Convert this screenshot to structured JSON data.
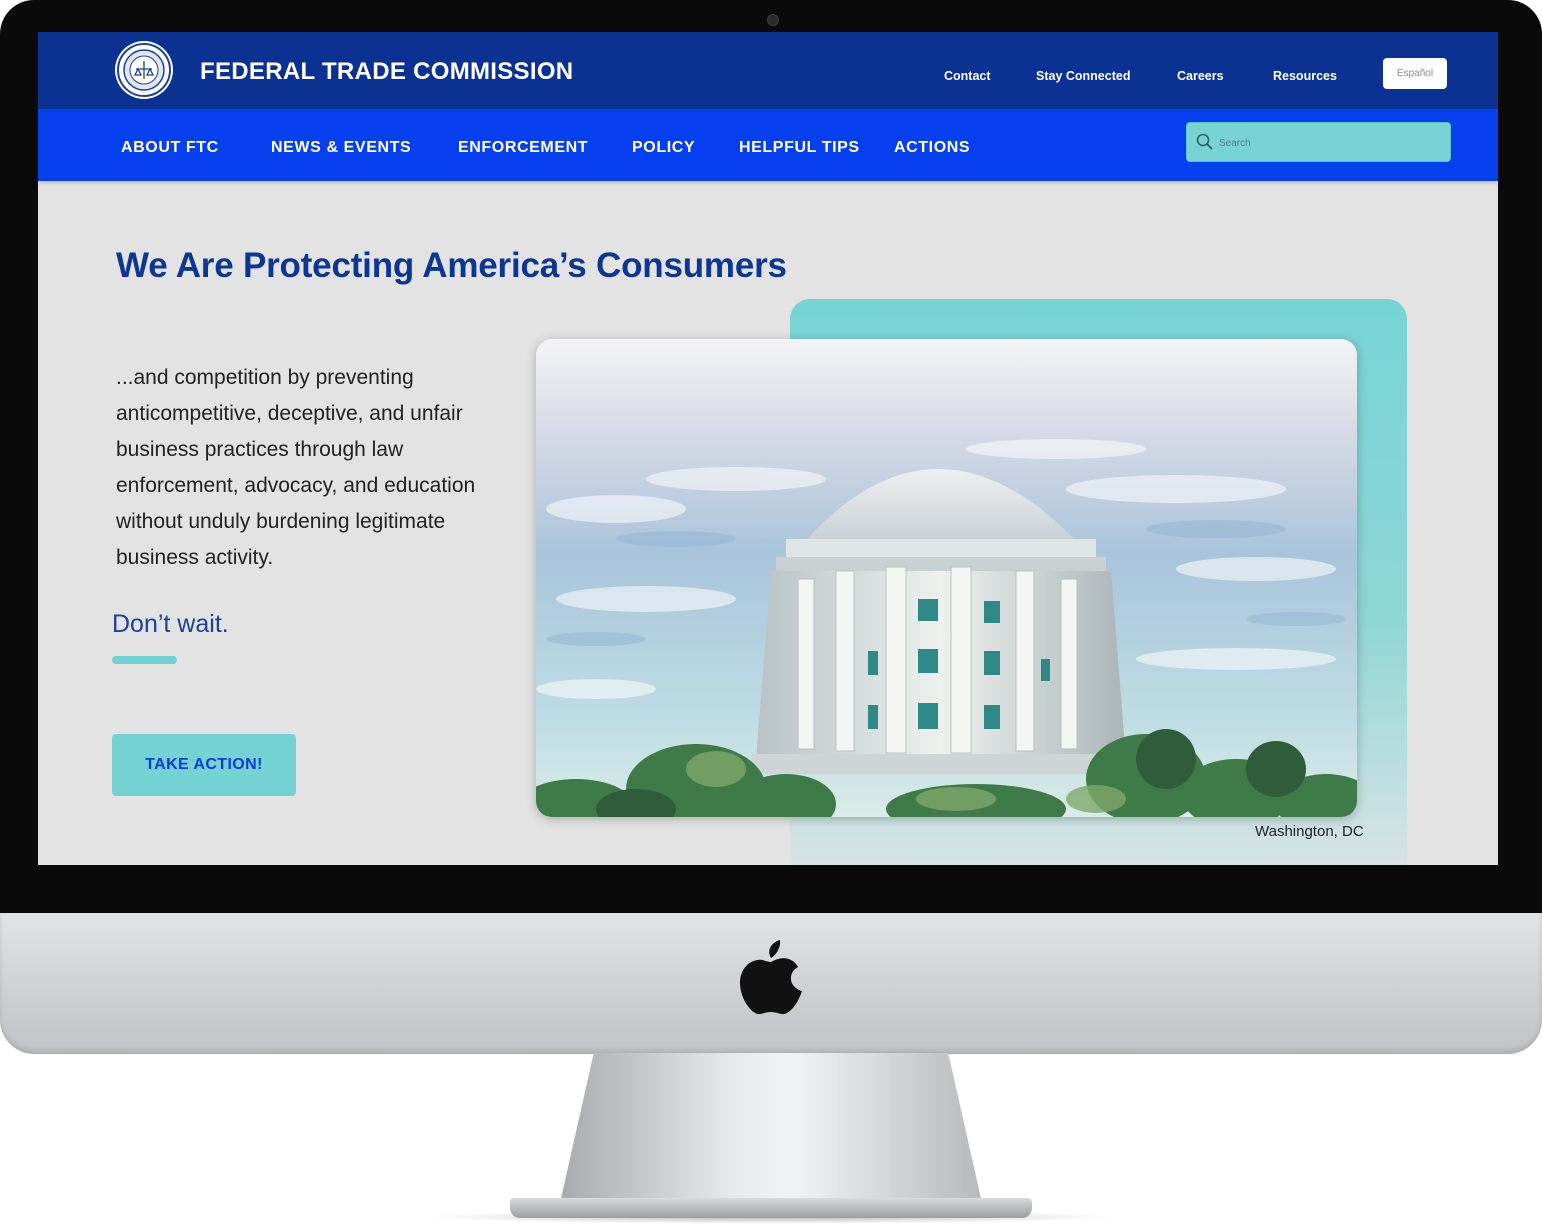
{
  "header": {
    "brand": "FEDERAL TRADE COMMISSION",
    "utility_links": [
      "Contact",
      "Stay Connected",
      "Careers",
      "Resources"
    ],
    "language_button": "Español"
  },
  "nav": {
    "items": [
      "ABOUT FTC",
      "NEWS & EVENTS",
      "ENFORCEMENT",
      "POLICY",
      "HELPFUL TIPS",
      "ACTIONS"
    ],
    "search_placeholder": "Search"
  },
  "hero": {
    "headline": "We Are Protecting America’s Consumers",
    "body": "...and competition by preventing anticompetitive, deceptive, and unfair business practices through law enforcement, advocacy, and education without unduly burdening legitimate business activity.",
    "cta_text": "Don’t wait.",
    "button_label": "TAKE ACTION!",
    "image_caption": "Washington, DC"
  },
  "icons": {
    "seal": "ftc-seal-icon",
    "search": "search-icon",
    "apple": "apple-logo-icon",
    "camera": "camera-icon"
  },
  "colors": {
    "topbar": "#0b3192",
    "navbar": "#0640ee",
    "accent_teal": "#74d2d3",
    "headline": "#0c3693",
    "page_background": "#e3e3e4"
  }
}
